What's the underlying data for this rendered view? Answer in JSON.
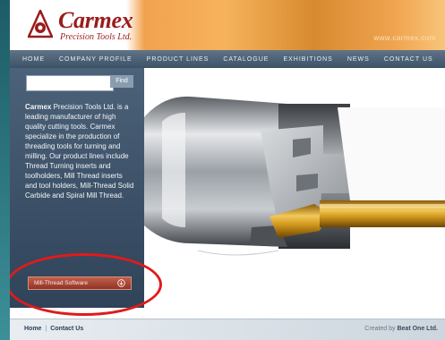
{
  "header": {
    "logo_name": "Carmex",
    "logo_subtitle": "Precision Tools Ltd.",
    "site_url": "www.carmex.com"
  },
  "nav": {
    "items": [
      "Home",
      "Company Profile",
      "Product Lines",
      "Catalogue",
      "Exhibitions",
      "News",
      "Contact Us"
    ]
  },
  "sidebar": {
    "search_value": "",
    "search_button": "Find",
    "description_brand": "Carmex",
    "description_text": " Precision Tools Ltd. is a leading manufacturer of high quality cutting tools. Carmex specialize in the production of threading tools for turning and milling. Our product lines include Thread Turning inserts and toolholders, Mill Thread inserts and tool holders, Mill-Thread Solid Carbide and Spiral Mill Thread.",
    "download_button": "Mill-Thread Software"
  },
  "footer": {
    "home_link": "Home",
    "separator": "|",
    "contact_link": "Contact Us",
    "credit_prefix": "Created by ",
    "credit_name": "Beat One Ltd."
  },
  "colors": {
    "brand_red": "#9b1b1b",
    "nav_bg": "#4c6279",
    "annotation_red": "#e01b1b"
  }
}
